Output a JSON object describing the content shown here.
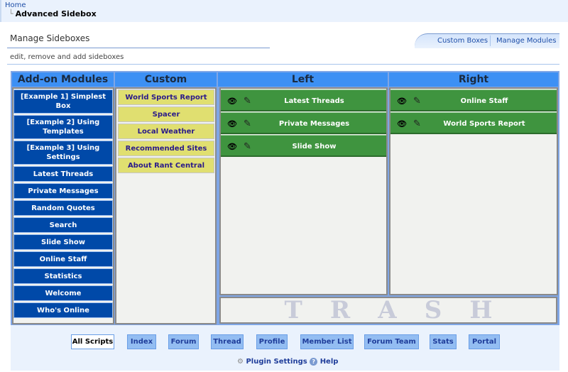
{
  "breadcrumb": {
    "home": "Home",
    "current": "Advanced Sidebox"
  },
  "page": {
    "title": "Manage Sideboxes",
    "subtitle": "edit, remove and add sideboxes"
  },
  "tabs": [
    "Custom Boxes",
    "Manage Modules"
  ],
  "columns": {
    "addon": "Add-on Modules",
    "custom": "Custom",
    "left": "Left",
    "right": "Right"
  },
  "addon_modules": [
    "[Example 1] Simplest Box",
    "[Example 2] Using Templates",
    "[Example 3] Using Settings",
    "Latest Threads",
    "Private Messages",
    "Random Quotes",
    "Search",
    "Slide Show",
    "Online Staff",
    "Statistics",
    "Welcome",
    "Who's Online"
  ],
  "custom_boxes": [
    "World Sports Report",
    "Spacer",
    "Local Weather",
    "Recommended Sites",
    "About Rant Central"
  ],
  "left_boxes": [
    "Latest Threads",
    "Private Messages",
    "Slide Show"
  ],
  "right_boxes": [
    "Online Staff",
    "World Sports Report"
  ],
  "trash_letters": [
    "T",
    "R",
    "A",
    "S",
    "H"
  ],
  "filters": [
    "All Scripts",
    "Index",
    "Forum",
    "Thread",
    "Profile",
    "Member List",
    "Forum Team",
    "Stats",
    "Portal"
  ],
  "active_filter": "All Scripts",
  "footer": {
    "settings": "Plugin Settings",
    "help": "Help"
  },
  "icons": {
    "view": "eye-icon",
    "edit": "pencil-icon",
    "settings": "gear-icon",
    "help": "help-icon"
  }
}
